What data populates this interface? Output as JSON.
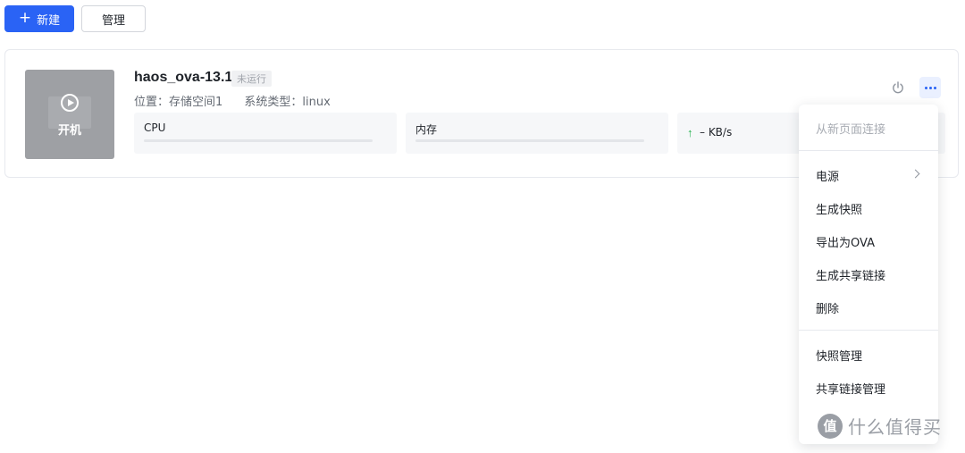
{
  "toolbar": {
    "new_label": "新建",
    "new_icon": "plus-icon",
    "manage_label": "管理"
  },
  "vm": {
    "thumbnail_label": "开机",
    "name": "haos_ova-13.1",
    "status": "未运行",
    "location_label": "位置：存储空间1",
    "os_label": "系统类型：linux",
    "cpu_label": "CPU",
    "cpu_usage": 0,
    "memory_label": "内存",
    "memory_usage": 0,
    "network_value": "– KB/s"
  },
  "menu": {
    "connect_new_page": "从新页面连接",
    "power": "电源",
    "snapshot": "生成快照",
    "export_ova": "导出为OVA",
    "share_link": "生成共享链接",
    "delete": "删除",
    "snapshot_manage": "快照管理",
    "share_link_manage": "共享链接管理"
  },
  "watermark": {
    "logo_char": "值",
    "text": "什么值得买"
  },
  "colors": {
    "primary": "#2a63f5",
    "network_up": "#22b14c",
    "thumbnail_bg": "#9ea0a4"
  }
}
